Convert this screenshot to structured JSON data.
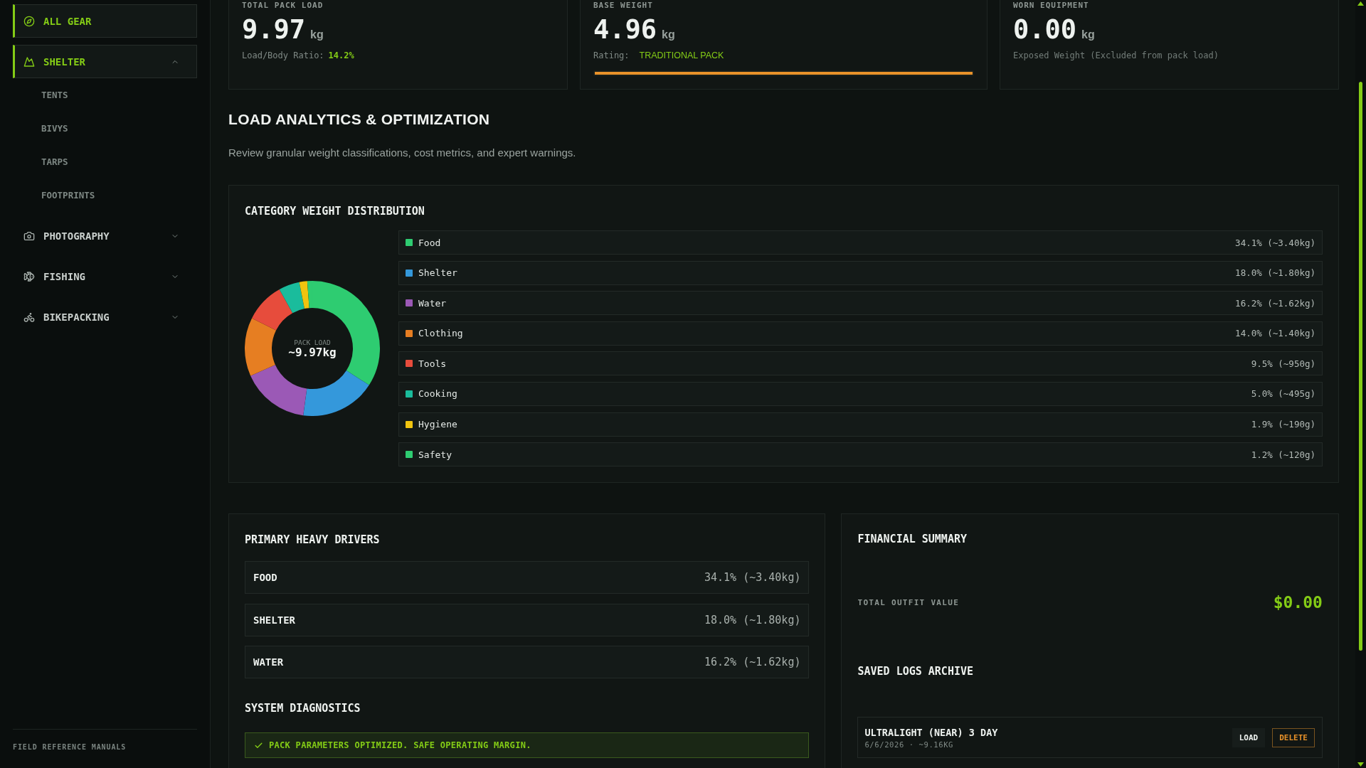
{
  "sidebar": {
    "items": [
      {
        "kind": "link",
        "label": "ALL GEAR",
        "selected": true
      },
      {
        "kind": "category",
        "label": "SHELTER",
        "selected": true,
        "expanded": true,
        "children": [
          {
            "label": "TENTS",
            "selected": false
          },
          {
            "label": "BIVYS",
            "selected": false
          },
          {
            "label": "TARPS",
            "selected": false
          },
          {
            "label": "FOOTPRINTS",
            "selected": false
          }
        ]
      },
      {
        "kind": "category",
        "label": "PHOTOGRAPHY",
        "selected": false,
        "expanded": false
      },
      {
        "kind": "category",
        "label": "FISHING",
        "selected": false,
        "expanded": false
      },
      {
        "kind": "category",
        "label": "BIKEPACKING",
        "selected": false,
        "expanded": false
      }
    ],
    "footer": "FIELD REFERENCE MANUALS"
  },
  "stats": [
    {
      "kind": "ratio",
      "label": "TOTAL PACK LOAD",
      "value": "9.97",
      "unit": "kg",
      "detail_label": "Load/Body Ratio:",
      "detail_value": "14.2%"
    },
    {
      "kind": "rating",
      "label": "BASE WEIGHT",
      "value": "4.96",
      "unit": "kg",
      "detail_label": "Rating:",
      "detail_value": "TRADITIONAL PACK",
      "level": 1
    },
    {
      "kind": "note",
      "label": "WORN EQUIPMENT",
      "value": "0.00",
      "unit": "kg",
      "note": "Exposed Weight (Excluded from pack load)"
    }
  ],
  "analytics": {
    "title": "LOAD ANALYTICS & OPTIMIZATION",
    "subtitle": "Review granular weight classifications, cost metrics, and expert warnings."
  },
  "distribution": {
    "title": "CATEGORY WEIGHT DISTRIBUTION",
    "center_label": "PACK LOAD",
    "center_value": "~9.97kg",
    "chart_data": {
      "type": "donut",
      "categories": [
        "Food",
        "Shelter",
        "Water",
        "Clothing",
        "Tools",
        "Cooking",
        "Hygiene",
        "Safety"
      ],
      "values": [
        34.1,
        18.0,
        16.2,
        14.0,
        9.5,
        5.0,
        1.9,
        1.2
      ],
      "colors": [
        "#2ecc71",
        "#3498db",
        "#9b59b6",
        "#e67e22",
        "#e74c3c",
        "#1abc9c",
        "#f1c40f",
        "#2ecc71"
      ],
      "legend": "right"
    },
    "readings": [
      "34.1% (~3.40kg)",
      "18.0% (~1.80kg)",
      "16.2% (~1.62kg)",
      "14.0% (~1.40kg)",
      "9.5% (~950g)",
      "5.0% (~495g)",
      "1.9% (~190g)",
      "1.2% (~120g)"
    ]
  },
  "drivers": {
    "title": "PRIMARY HEAVY DRIVERS",
    "rows": [
      {
        "name": "FOOD",
        "value": "34.1% (~3.40kg)"
      },
      {
        "name": "SHELTER",
        "value": "18.0% (~1.80kg)"
      },
      {
        "name": "WATER",
        "value": "16.2% (~1.62kg)"
      }
    ]
  },
  "diagnostics": {
    "title": "SYSTEM DIAGNOSTICS",
    "status": {
      "kind": "ok",
      "text": "PACK PARAMETERS OPTIMIZED. SAFE OPERATING MARGIN."
    }
  },
  "financial": {
    "title": "FINANCIAL SUMMARY",
    "total_label": "TOTAL OUTFIT VALUE",
    "total_value": "$0.00"
  },
  "archive": {
    "title": "SAVED LOGS ARCHIVE",
    "logs": [
      {
        "name": "ULTRALIGHT (NEAR) 3 DAY",
        "meta": "6/6/2026 · ~9.16KG",
        "actions": [
          {
            "kind": "load",
            "label": "LOAD"
          },
          {
            "kind": "delete",
            "label": "DELETE"
          }
        ]
      }
    ]
  }
}
